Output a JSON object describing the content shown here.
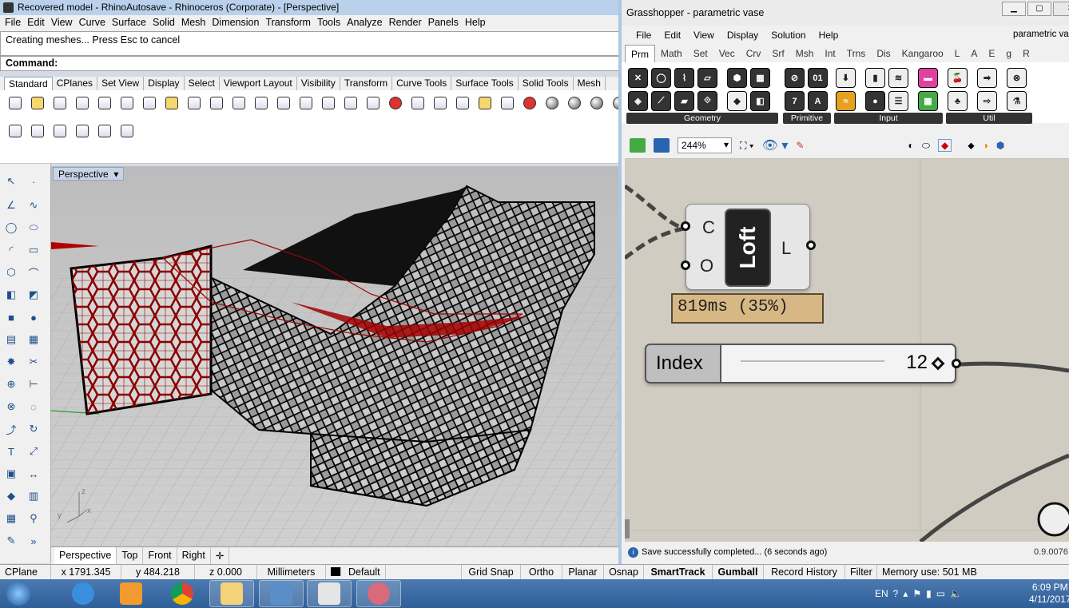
{
  "rhino": {
    "title": "Recovered model - RhinoAutosave - Rhinoceros (Corporate) - [Perspective]",
    "menu": [
      "File",
      "Edit",
      "View",
      "Curve",
      "Surface",
      "Solid",
      "Mesh",
      "Dimension",
      "Transform",
      "Tools",
      "Analyze",
      "Render",
      "Panels",
      "Help"
    ],
    "history": "Creating meshes... Press Esc to cancel",
    "command_label": "Command:",
    "toolbar_tabs": [
      "Standard",
      "CPlanes",
      "Set View",
      "Display",
      "Select",
      "Viewport Layout",
      "Visibility",
      "Transform",
      "Curve Tools",
      "Surface Tools",
      "Solid Tools",
      "Mesh"
    ],
    "viewport_label": "Perspective",
    "viewport_tabs": [
      "Perspective",
      "Top",
      "Front",
      "Right"
    ],
    "axis": {
      "x": "x",
      "y": "y",
      "z": "z"
    },
    "status": {
      "cplane": "CPlane",
      "x": "x 1791.345",
      "y": "y 484.218",
      "z": "z 0.000",
      "units": "Millimeters",
      "layer": "Default",
      "grid_snap": "Grid Snap",
      "ortho": "Ortho",
      "planar": "Planar",
      "osnap": "Osnap",
      "smarttrack": "SmartTrack",
      "gumball": "Gumball",
      "record_history": "Record History",
      "filter": "Filter",
      "memory": "Memory use: 501 MB"
    }
  },
  "grasshopper": {
    "title": "Grasshopper - parametric vase",
    "menu": [
      "File",
      "Edit",
      "View",
      "Display",
      "Solution",
      "Help"
    ],
    "doc_name": "parametric vase",
    "tabs": [
      "Prm",
      "Math",
      "Set",
      "Vec",
      "Crv",
      "Srf",
      "Msh",
      "Int",
      "Trns",
      "Dis",
      "Kangaroo",
      "L",
      "A",
      "E",
      "g",
      "R"
    ],
    "groups": [
      "Geometry",
      "Primitive",
      "Input",
      "Util"
    ],
    "zoom": "244%",
    "loft": {
      "name": "Loft",
      "inputs": [
        "C",
        "O"
      ],
      "output": "L"
    },
    "profiler": "819ms (35%)",
    "slider": {
      "name": "Index",
      "value": "12"
    },
    "status": "Save successfully completed... (6 seconds ago)",
    "version": "0.9.0076"
  },
  "taskbar": {
    "lang": "EN",
    "time": "6:09 PM",
    "date": "4/11/2017"
  }
}
